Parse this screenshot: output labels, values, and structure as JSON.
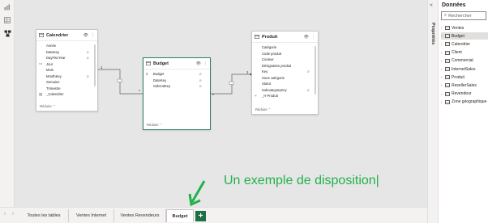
{
  "canvas": {
    "tables": {
      "calendrier": {
        "title": "Calendrier",
        "fields": [
          {
            "name": "Année",
            "icon": "",
            "hidden": false
          },
          {
            "name": "DateKey",
            "icon": "",
            "hidden": true
          },
          {
            "name": "DayFiscYear",
            "icon": "",
            "hidden": true
          },
          {
            "name": "Jour",
            "icon": "field-icon",
            "hidden": false
          },
          {
            "name": "Mois",
            "icon": "",
            "hidden": false
          },
          {
            "name": "MonthKey",
            "icon": "",
            "hidden": true
          },
          {
            "name": "Semaine",
            "icon": "",
            "hidden": false
          },
          {
            "name": "Trimestre",
            "icon": "",
            "hidden": false
          },
          {
            "name": "_Calendrier",
            "icon": "measure-icon",
            "hidden": false
          }
        ],
        "footer": "Réduire ⌃"
      },
      "budget": {
        "title": "Budget",
        "fields": [
          {
            "name": "Budget",
            "icon": "sigma-icon",
            "hidden": true
          },
          {
            "name": "DateKey",
            "icon": "",
            "hidden": true
          },
          {
            "name": "SubCatKey",
            "icon": "",
            "hidden": true
          }
        ],
        "footer": "Réduire ⌃"
      },
      "produit": {
        "title": "Produit",
        "fields": [
          {
            "name": "Catégorie",
            "icon": "",
            "hidden": false
          },
          {
            "name": "Code produit",
            "icon": "",
            "hidden": false
          },
          {
            "name": "Couleur",
            "icon": "",
            "hidden": false
          },
          {
            "name": "Désignation produit",
            "icon": "",
            "hidden": false
          },
          {
            "name": "Key",
            "icon": "",
            "hidden": true
          },
          {
            "name": "Sous catégorie",
            "icon": "",
            "hidden": false
          },
          {
            "name": "Statut",
            "icon": "",
            "hidden": false
          },
          {
            "name": "SubcategoryKey",
            "icon": "",
            "hidden": true
          },
          {
            "name": "_H Produit",
            "icon": "hierarchy-icon",
            "hidden": false
          }
        ],
        "footer": "Réduire ⌃"
      }
    },
    "relationships": {
      "left": {
        "many": "*",
        "one": "1"
      },
      "right": {
        "many": "*",
        "one": "1"
      }
    },
    "annotation": "Un exemple de disposition|"
  },
  "bottom_tabs": {
    "tabs": [
      "Toutes les tables",
      "Ventes Internet",
      "Ventes Revendeurs",
      "Budget"
    ],
    "active": "Budget",
    "add_label": "+"
  },
  "properties_pane": {
    "label": "Propriétés",
    "collapse": "«"
  },
  "data_pane": {
    "title": "Données",
    "search_placeholder": "Rechercher",
    "items": [
      "Ventes",
      "Budget",
      "Calendrier",
      "Client",
      "Commercial",
      "InternetSales",
      "Produit",
      "ResellerSales",
      "Revendeur",
      "Zone géographique"
    ],
    "selected": "Budget"
  },
  "colors": {
    "accent_green": "#22b14c",
    "selected_border": "#2e7d62",
    "add_button": "#1e7145"
  }
}
